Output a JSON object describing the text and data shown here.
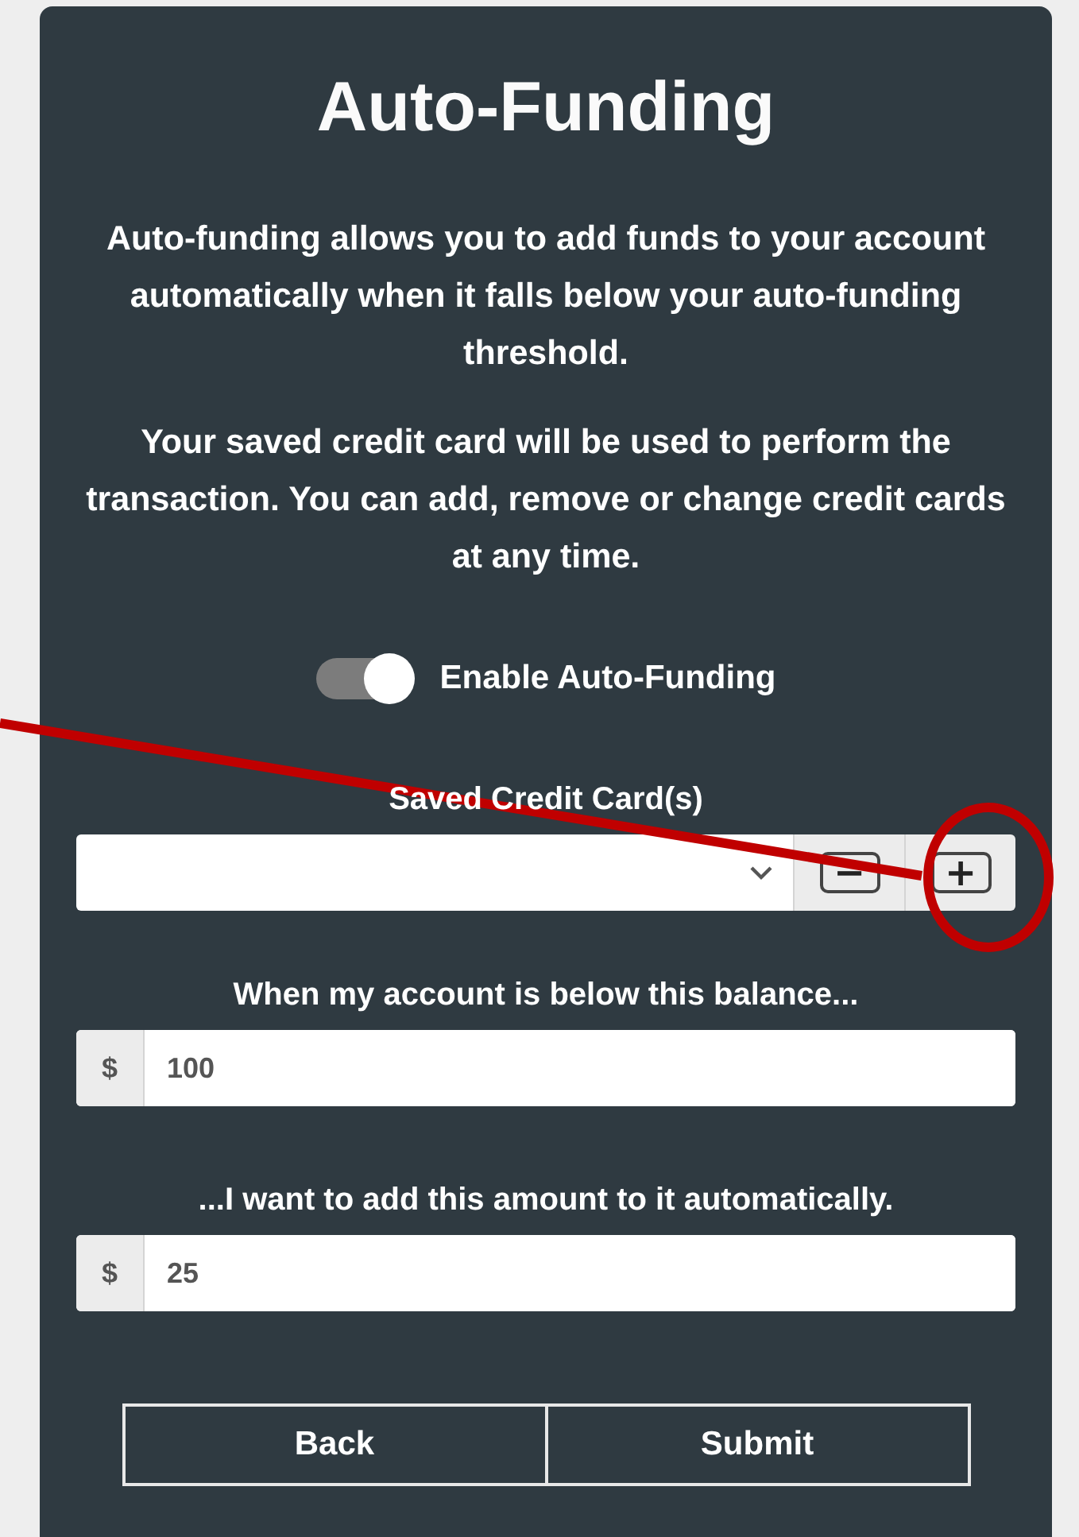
{
  "title": "Auto-Funding",
  "paragraphs": [
    "Auto-funding allows you to add funds to your account automatically when it falls below your auto-funding threshold.",
    "Your saved credit card will be used to perform the transaction. You can add, remove or change credit cards at any time."
  ],
  "toggle": {
    "label": "Enable Auto-Funding",
    "on": true
  },
  "card_select": {
    "label": "Saved Credit Card(s)",
    "remove": "−",
    "add": "+"
  },
  "amounts": [
    {
      "label": "When my account is below this balance...",
      "prefix": "$",
      "value": "100"
    },
    {
      "label": "...I want to add this amount to it automatically.",
      "prefix": "$",
      "value": "25"
    }
  ],
  "buttons": [
    "Back",
    "Submit"
  ],
  "annotation": {
    "kind": "arrow-circle"
  }
}
